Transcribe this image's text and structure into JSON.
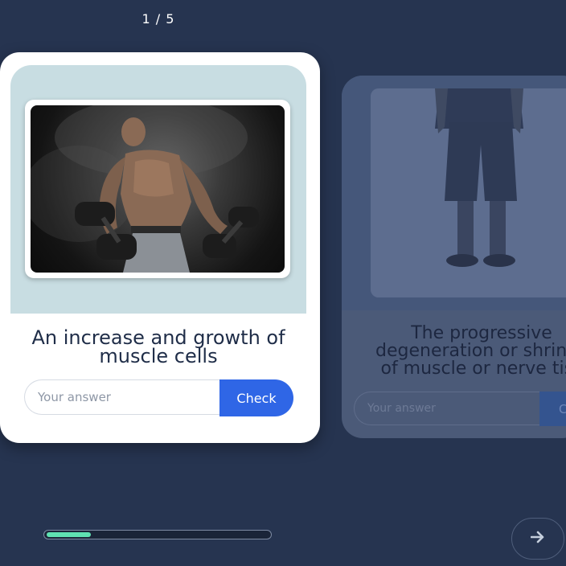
{
  "counter": "1 / 5",
  "progress": {
    "fraction": 0.2
  },
  "card": {
    "prompt": "An increase and growth of muscle cells",
    "answer_placeholder": "Your answer",
    "check_label": "Check"
  },
  "next_card": {
    "prompt": "The progressive\ndegeneration or shrinka\nof muscle or nerve tiss",
    "answer_placeholder": "Your answer",
    "check_label": "C"
  },
  "colors": {
    "background": "#263450",
    "accent": "#2f66e6",
    "progress_fill": "#5fe1b2"
  },
  "icons": {
    "next": "arrow-right-icon"
  }
}
